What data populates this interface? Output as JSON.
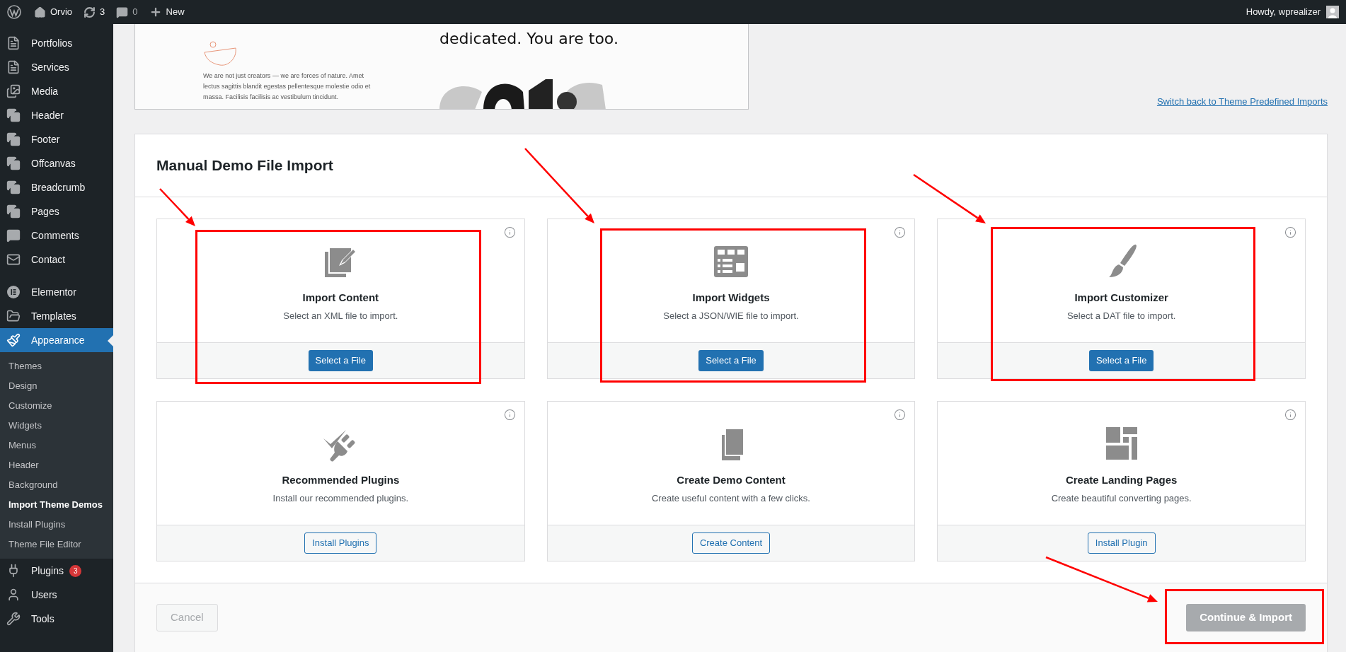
{
  "admin_bar": {
    "site": "Orvio",
    "updates": "3",
    "comments": "0",
    "new": "New",
    "greeting": "Howdy, wprealizer"
  },
  "sidebar": {
    "groups": [
      {
        "items": [
          {
            "label": "Portfolios",
            "selected": false
          },
          {
            "label": "Services",
            "selected": false
          },
          {
            "label": "Media",
            "selected": false
          },
          {
            "label": "Header",
            "selected": false
          },
          {
            "label": "Footer",
            "selected": false
          },
          {
            "label": "Offcanvas",
            "selected": false
          },
          {
            "label": "Breadcrumb",
            "selected": false
          },
          {
            "label": "Pages",
            "selected": false
          },
          {
            "label": "Comments",
            "selected": false
          },
          {
            "label": "Contact",
            "selected": false
          }
        ]
      },
      {
        "items": [
          {
            "label": "Elementor",
            "selected": false
          },
          {
            "label": "Templates",
            "selected": false
          },
          {
            "label": "Appearance",
            "selected": true,
            "submenu": [
              {
                "label": "Themes",
                "selected": false
              },
              {
                "label": "Design",
                "selected": false
              },
              {
                "label": "Customize",
                "selected": false
              },
              {
                "label": "Widgets",
                "selected": false
              },
              {
                "label": "Menus",
                "selected": false
              },
              {
                "label": "Header",
                "selected": false
              },
              {
                "label": "Background",
                "selected": false
              },
              {
                "label": "Import Theme Demos",
                "selected": true
              },
              {
                "label": "Install Plugins",
                "selected": false
              },
              {
                "label": "Theme File Editor",
                "selected": false
              }
            ]
          },
          {
            "label": "Plugins",
            "selected": false,
            "badge": "3"
          },
          {
            "label": "Users",
            "selected": false
          },
          {
            "label": "Tools",
            "selected": false
          }
        ]
      }
    ]
  },
  "preview": {
    "headline": [
      "dedicated. You are too."
    ],
    "body": "We are not just creators — we are forces of nature. Amet lectus sagittis blandit egestas pellentesque molestie odio et massa. Facilisis facilisis ac vestibulum tincidunt."
  },
  "switch_link": "Switch back to Theme Predefined Imports",
  "panel": {
    "title": "Manual Demo File Import",
    "cards": [
      {
        "title": "Import Content",
        "description": "Select an XML file to import.",
        "button": "Select a File",
        "kind": "primary",
        "highlighted": true
      },
      {
        "title": "Import Widgets",
        "description": "Select a JSON/WIE file to import.",
        "button": "Select a File",
        "kind": "primary",
        "highlighted": true
      },
      {
        "title": "Import Customizer",
        "description": "Select a DAT file to import.",
        "button": "Select a File",
        "kind": "primary",
        "highlighted": true
      },
      {
        "title": "Recommended Plugins",
        "description": "Install our recommended plugins.",
        "button": "Install Plugins",
        "kind": "secondary",
        "highlighted": false
      },
      {
        "title": "Create Demo Content",
        "description": "Create useful content with a few clicks.",
        "button": "Create Content",
        "kind": "secondary",
        "highlighted": false
      },
      {
        "title": "Create Landing Pages",
        "description": "Create beautiful converting pages.",
        "button": "Install Plugin",
        "kind": "secondary",
        "highlighted": false
      }
    ],
    "cancel": {
      "label": "Cancel",
      "disabled": true
    },
    "continue": {
      "label": "Continue & Import",
      "disabled": true,
      "highlighted": true
    }
  }
}
